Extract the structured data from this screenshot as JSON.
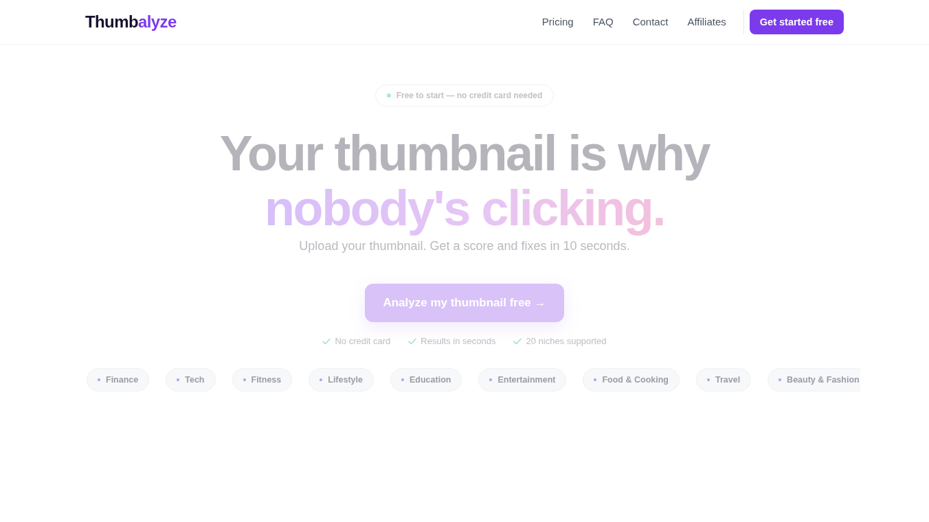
{
  "header": {
    "logo": {
      "text": "Thumb",
      "accent": "alyze"
    },
    "nav": [
      "Pricing",
      "FAQ",
      "Contact",
      "Affiliates"
    ],
    "cta": "Get started free"
  },
  "hero": {
    "badge": "Free to start — no credit card needed",
    "headline": "Your thumbnail is why",
    "highlight": "nobody's clicking.",
    "subtitle": "Upload your thumbnail. Get a score and fixes in 10 seconds.",
    "cta": "Analyze my thumbnail free →",
    "perks": [
      "No credit card",
      "Results in seconds",
      "20 niches supported"
    ]
  },
  "niches": [
    "Finance",
    "Tech",
    "Fitness",
    "Lifestyle",
    "Education",
    "Entertainment",
    "Food & Cooking",
    "Travel",
    "Beauty & Fashion"
  ]
}
